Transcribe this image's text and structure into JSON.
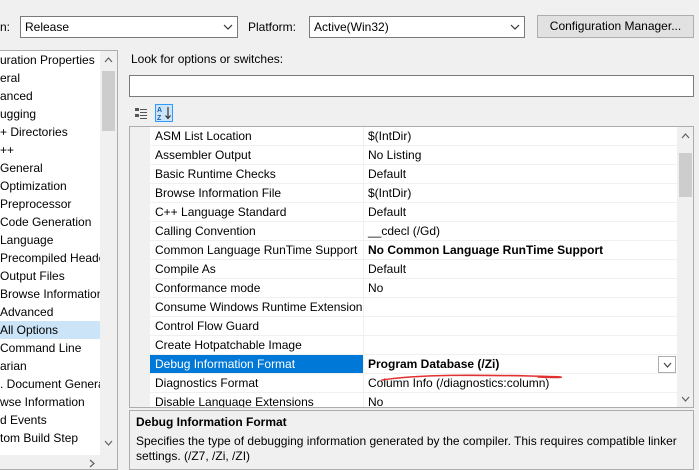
{
  "toolbar": {
    "configuration_label": "n:",
    "configuration_value": "Release",
    "platform_label": "Platform:",
    "platform_value": "Active(Win32)",
    "config_manager_label": "Configuration Manager..."
  },
  "tree": {
    "items": [
      {
        "label": "uration Properties",
        "indent": 0
      },
      {
        "label": "eral",
        "indent": 0
      },
      {
        "label": "anced",
        "indent": 0
      },
      {
        "label": "ugging",
        "indent": 0
      },
      {
        "label": "+ Directories",
        "indent": 0
      },
      {
        "label": "++",
        "indent": 0
      },
      {
        "label": "General",
        "indent": 0
      },
      {
        "label": "Optimization",
        "indent": 0
      },
      {
        "label": "Preprocessor",
        "indent": 0
      },
      {
        "label": "Code Generation",
        "indent": 0
      },
      {
        "label": "Language",
        "indent": 0
      },
      {
        "label": "Precompiled Heade",
        "indent": 0
      },
      {
        "label": "Output Files",
        "indent": 0
      },
      {
        "label": "Browse Information",
        "indent": 0
      },
      {
        "label": "Advanced",
        "indent": 0
      },
      {
        "label": "All Options",
        "indent": 0,
        "selected": true
      },
      {
        "label": "Command Line",
        "indent": 0
      },
      {
        "label": "arian",
        "indent": 0
      },
      {
        "label": ". Document Genera",
        "indent": 0
      },
      {
        "label": "wse Information",
        "indent": 0
      },
      {
        "label": "d Events",
        "indent": 0
      },
      {
        "label": "tom Build Step",
        "indent": 0
      }
    ]
  },
  "search": {
    "label": "Look for options or switches:",
    "value": ""
  },
  "grid": {
    "rows": [
      {
        "name": "ASM List Location",
        "value": "$(IntDir)",
        "bold": false
      },
      {
        "name": "Assembler Output",
        "value": "No Listing",
        "bold": false
      },
      {
        "name": "Basic Runtime Checks",
        "value": "Default",
        "bold": false
      },
      {
        "name": "Browse Information File",
        "value": "$(IntDir)",
        "bold": false
      },
      {
        "name": "C++ Language Standard",
        "value": "Default",
        "bold": false
      },
      {
        "name": "Calling Convention",
        "value": "__cdecl (/Gd)",
        "bold": false
      },
      {
        "name": "Common Language RunTime Support",
        "value": "No Common Language RunTime Support",
        "bold": true
      },
      {
        "name": "Compile As",
        "value": "Default",
        "bold": false
      },
      {
        "name": "Conformance mode",
        "value": "No",
        "bold": false
      },
      {
        "name": "Consume Windows Runtime Extension",
        "value": "",
        "bold": false
      },
      {
        "name": "Control Flow Guard",
        "value": "",
        "bold": false
      },
      {
        "name": "Create Hotpatchable Image",
        "value": "",
        "bold": false
      },
      {
        "name": "Debug Information Format",
        "value": "Program Database (/Zi)",
        "bold": true,
        "selected": true
      },
      {
        "name": "Diagnostics Format",
        "value": "Column Info (/diagnostics:column)",
        "bold": false
      },
      {
        "name": "Disable Language Extensions",
        "value": "No",
        "bold": false
      }
    ]
  },
  "description": {
    "title": "Debug Information Format",
    "text": "Specifies the type of debugging information generated by the compiler.  This requires compatible linker settings.    (/Z7, /Zi, /ZI)"
  },
  "colors": {
    "selection": "#0078d7",
    "tree_selection": "#cce4f7",
    "annotation": "#e03030"
  }
}
